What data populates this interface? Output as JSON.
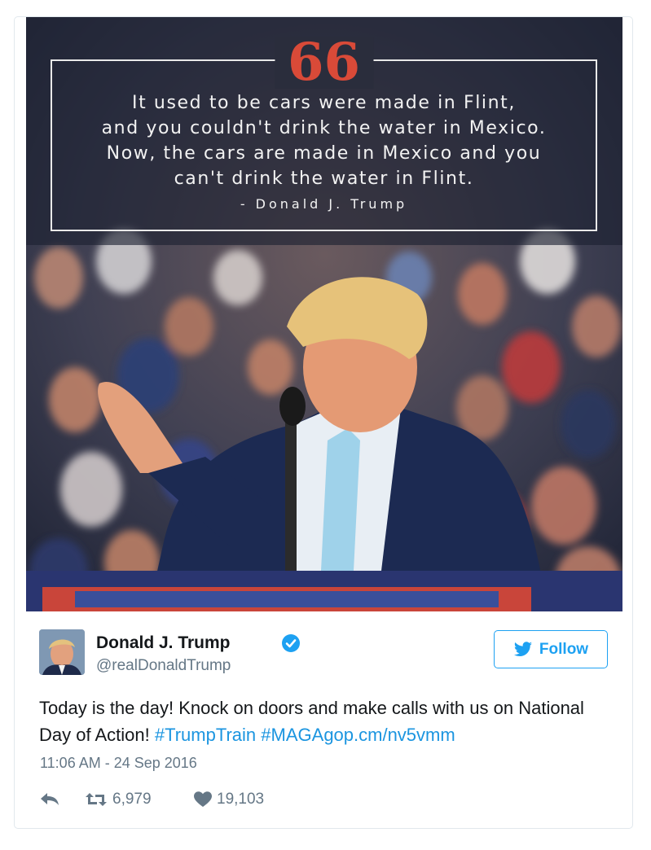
{
  "media": {
    "quote": {
      "mark": "66",
      "lines": [
        "It used to be cars were made in Flint,",
        "and you couldn't drink the water in Mexico.",
        "Now, the cars are made in Mexico and you",
        "can't drink the water in Flint."
      ],
      "author": "- Donald J. Trump"
    }
  },
  "tweet": {
    "display_name": "Donald J. Trump",
    "handle": "@realDonaldTrump",
    "follow_label": "Follow",
    "text_plain": "Today is the day! Knock on doors and make calls with us on National Day of Action!",
    "hashtag_1": "#TrumpTrain",
    "hashtag_2": "#MAGAgop.cm/nv5vmm",
    "timestamp": "11:06 AM - 24 Sep 2016",
    "retweets": "6,979",
    "likes": "19,103"
  },
  "colors": {
    "link": "#1b95e0",
    "secondary_text": "#657786",
    "quote_mark": "#d94a38"
  }
}
